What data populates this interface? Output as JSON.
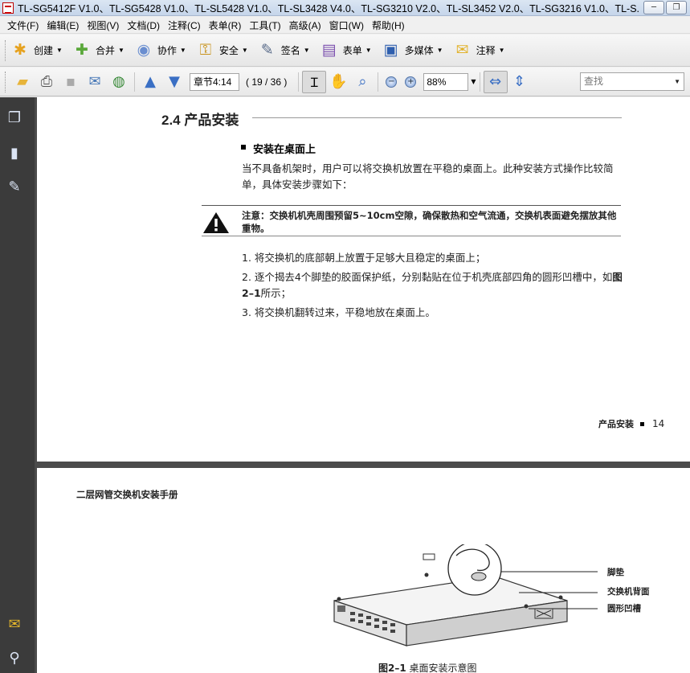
{
  "window": {
    "title": "TL-SG5412F V1.0、TL-SG5428 V1.0、TL-SL5428 V1.0、TL-SL3428 V4.0、TL-SG3210 V2.0、TL-SL3452 V2.0、TL-SG3216 V1.0、TL-S...",
    "minimize": "─",
    "restore": "❐"
  },
  "menu": [
    "文件(F)",
    "编辑(E)",
    "视图(V)",
    "文档(D)",
    "注释(C)",
    "表单(R)",
    "工具(T)",
    "高级(A)",
    "窗口(W)",
    "帮助(H)"
  ],
  "tasks": [
    {
      "label": "创建",
      "icon": "create-icon",
      "glyph": "✱",
      "color": "#e6a21f"
    },
    {
      "label": "合并",
      "icon": "combine-icon",
      "glyph": "✚",
      "color": "#5aa83a"
    },
    {
      "label": "协作",
      "icon": "collaborate-icon",
      "glyph": "◉",
      "color": "#6a8ed0"
    },
    {
      "label": "安全",
      "icon": "lock-icon",
      "glyph": "🔒",
      "color": "#c8931d"
    },
    {
      "label": "签名",
      "icon": "pen-icon",
      "glyph": "✎",
      "color": "#5a6c8a"
    },
    {
      "label": "表单",
      "icon": "form-icon",
      "glyph": "▤",
      "color": "#7b4fae"
    },
    {
      "label": "多媒体",
      "icon": "multimedia-icon",
      "glyph": "▣",
      "color": "#2f5fae"
    },
    {
      "label": "注释",
      "icon": "comment-icon",
      "glyph": "✉",
      "color": "#e2b22b"
    }
  ],
  "nav": {
    "chapter": "章节4:14",
    "page_count": "( 19 / 36 )",
    "zoom": "88%",
    "search_placeholder": "查找"
  },
  "page1": {
    "section_title": "2.4 产品安装",
    "subsection_title": "安装在桌面上",
    "intro": "当不具备机架时，用户可以将交换机放置在平稳的桌面上。此种安装方式操作比较简单，具体安装步骤如下：",
    "note": "注意：交换机机壳周围预留5~10cm空隙，确保散热和空气流通，交换机表面避免摆放其他重物。",
    "step1": "1. 将交换机的底部朝上放置于足够大且稳定的桌面上；",
    "step2a": "2. 逐个揭去4个脚垫的胶面保护纸，分别黏贴在位于机壳底部四角的圆形凹槽中，如",
    "step2b": "图 2–1",
    "step2c": "所示；",
    "step3": "3. 将交换机翻转过来，平稳地放在桌面上。",
    "footer_label": "产品安装",
    "footer_page": "14"
  },
  "page2": {
    "header": "二层网管交换机安装手册",
    "callout_foot": "脚垫",
    "callout_back": "交换机背面",
    "callout_groove": "圆形凹槽",
    "caption_num": "图2–1",
    "caption_text": " 桌面安装示意图"
  }
}
